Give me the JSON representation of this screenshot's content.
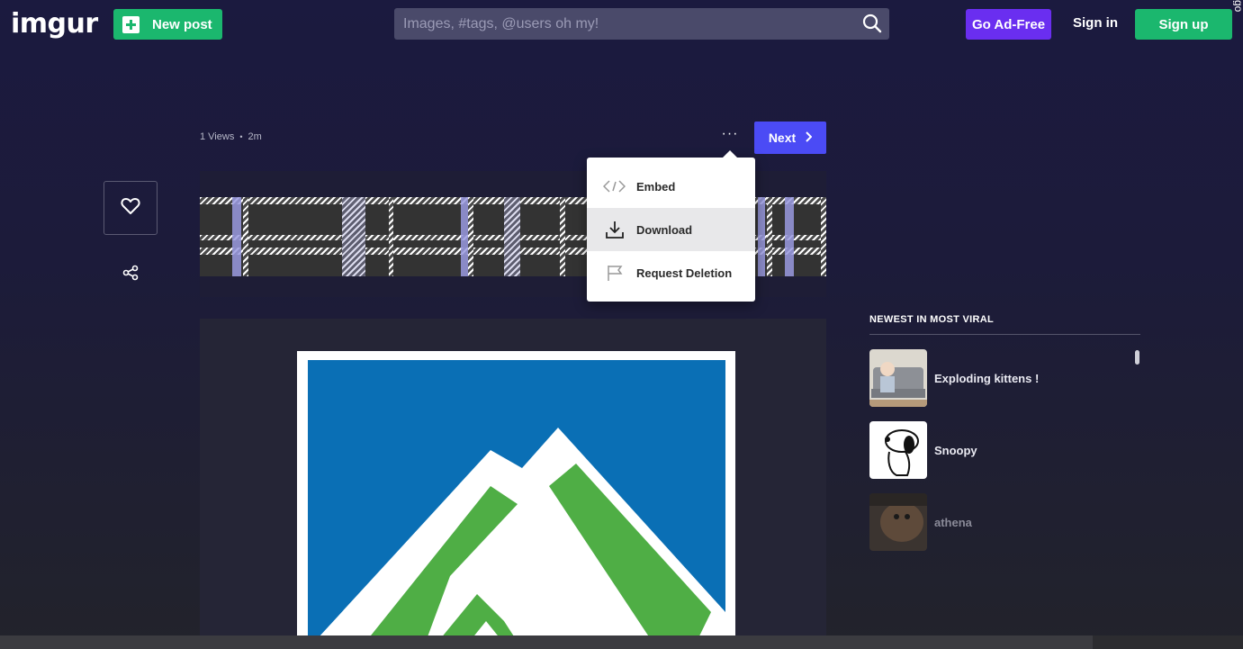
{
  "header": {
    "logo": "imgur",
    "new_post_label": "New post",
    "search_placeholder": "Images, #tags, @users oh my!",
    "ad_free_label": "Go Ad-Free",
    "sign_in_label": "Sign in",
    "sign_up_label": "Sign up",
    "edge_text": "go"
  },
  "post": {
    "views": "1 Views",
    "separator": "•",
    "age": "2m",
    "more_label": "···",
    "next_label": "Next"
  },
  "menu": {
    "items": [
      {
        "label": "Embed",
        "icon": "code-icon"
      },
      {
        "label": "Download",
        "icon": "download-icon"
      },
      {
        "label": "Request Deletion",
        "icon": "flag-icon"
      }
    ]
  },
  "sidebar": {
    "title": "NEWEST IN MOST VIRAL",
    "items": [
      {
        "title": "Exploding kittens !"
      },
      {
        "title": "Snoopy"
      },
      {
        "title": "athena"
      }
    ]
  },
  "colors": {
    "brand_green": "#1bb76e",
    "ad_free_purple": "#6a2ef0",
    "next_blue": "#4b4bf5",
    "logo_blue": "#0a6fb5",
    "logo_green": "#4fae45"
  }
}
